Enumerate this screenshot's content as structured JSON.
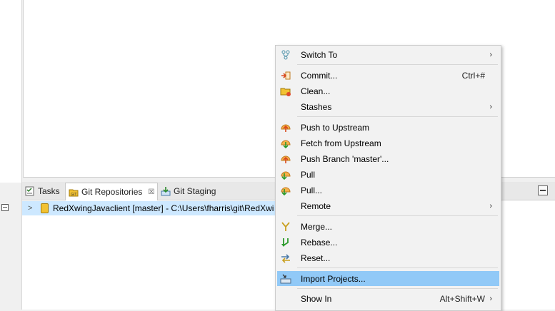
{
  "views": {
    "tabs": [
      {
        "label": "Tasks"
      },
      {
        "label": "Git Repositories",
        "close": "☒"
      },
      {
        "label": "Git Staging"
      }
    ]
  },
  "tree": {
    "repo_label": "RedXwingJavaclient [master] - C:\\Users\\fharris\\git\\RedXwi"
  },
  "menu": {
    "items": [
      {
        "label": "Switch To",
        "submenu": true
      },
      {
        "label": "Commit...",
        "shortcut": "Ctrl+#"
      },
      {
        "label": "Clean..."
      },
      {
        "label": "Stashes",
        "submenu": true
      },
      {
        "label": "Push to Upstream"
      },
      {
        "label": "Fetch from Upstream"
      },
      {
        "label": "Push Branch 'master'..."
      },
      {
        "label": "Pull"
      },
      {
        "label": "Pull..."
      },
      {
        "label": "Remote",
        "submenu": true
      },
      {
        "label": "Merge..."
      },
      {
        "label": "Rebase..."
      },
      {
        "label": "Reset..."
      },
      {
        "label": "Import Projects...",
        "highlighted": true
      },
      {
        "label": "Show In",
        "shortcut": "Alt+Shift+W",
        "submenu": true
      }
    ],
    "arrow_glyph": "›"
  },
  "colors": {
    "menu_highlight": "#91c9f7",
    "tree_selection": "#cde8ff",
    "repo_icon": "#f2c232"
  }
}
